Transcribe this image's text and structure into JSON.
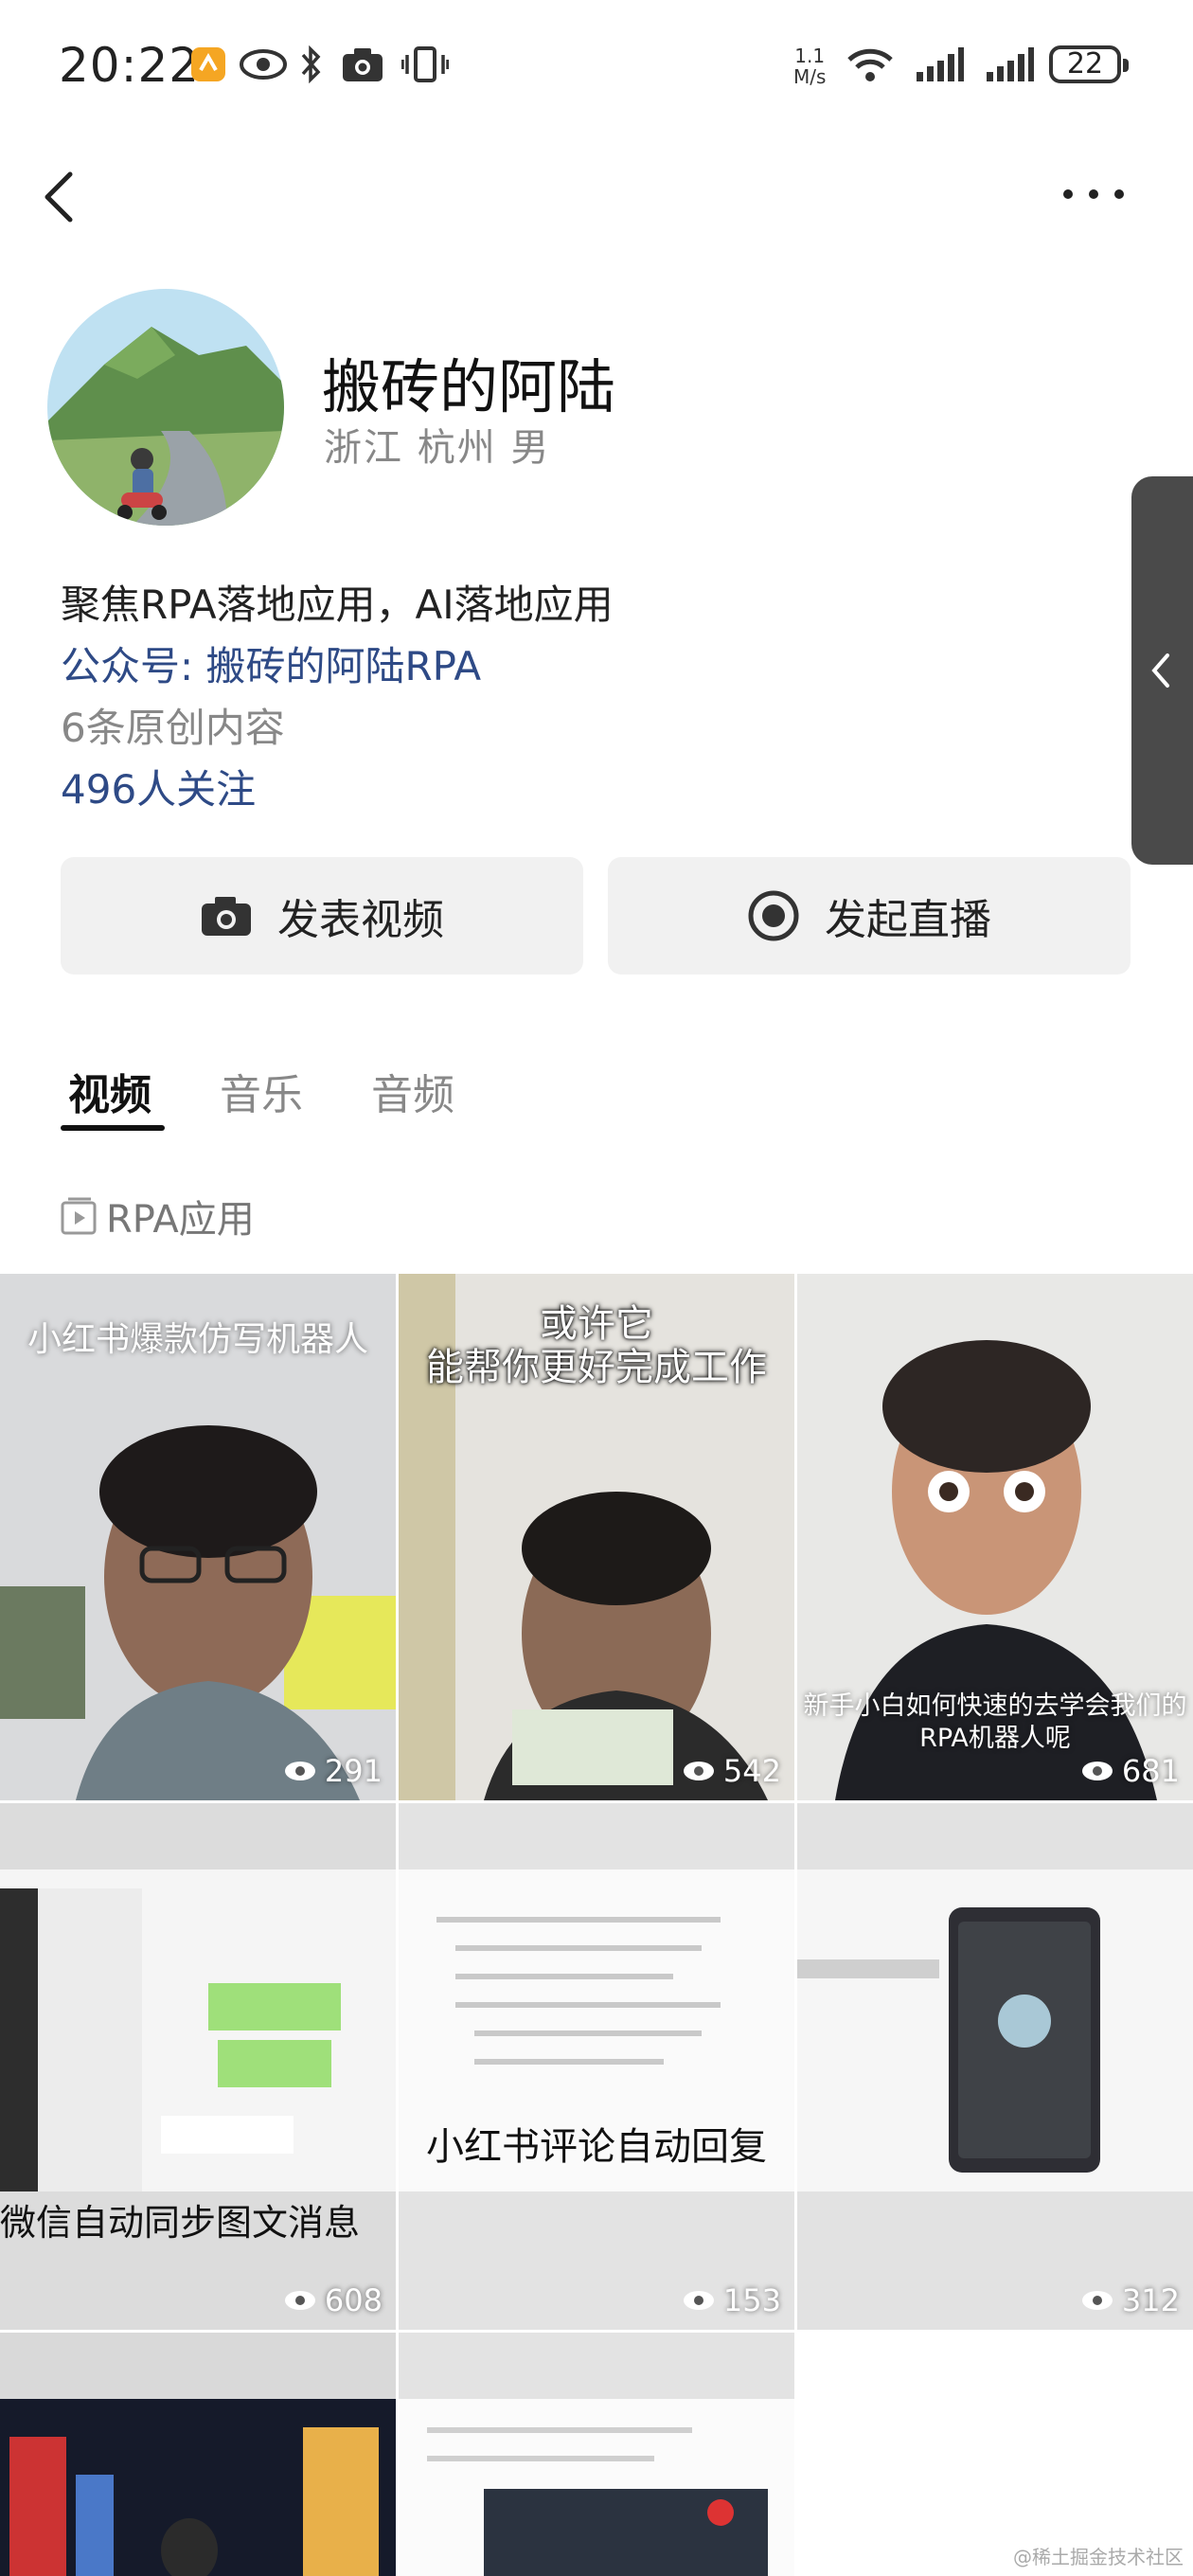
{
  "status_bar": {
    "time": "20:22",
    "net_speed_value": "1.1",
    "net_speed_unit": "M/s",
    "battery": "22"
  },
  "header": {
    "back_icon": "chevron-left-icon",
    "more_icon": "more-dots-icon"
  },
  "profile": {
    "name": "搬砖的阿陆",
    "location": "浙江 杭州 男",
    "bio": "聚焦RPA落地应用，AI落地应用",
    "official_account": "公众号: 搬砖的阿陆RPA",
    "original_count": "6条原创内容",
    "followers": "496人关注"
  },
  "actions": {
    "post_video": "发表视频",
    "start_live": "发起直播"
  },
  "tabs": [
    {
      "label": "视频",
      "active": true
    },
    {
      "label": "音乐",
      "active": false
    },
    {
      "label": "音频",
      "active": false
    }
  ],
  "collection": {
    "label": "RPA应用"
  },
  "videos": [
    {
      "caption": "小红书爆款仿写机器人",
      "views": "291"
    },
    {
      "caption": "或许它\n能帮你更好完成工作",
      "views": "542"
    },
    {
      "caption": "新手小白如何快速的去学会我们的\nRPA机器人呢",
      "views": "681"
    },
    {
      "caption": "微信自动同步图文消息",
      "views": "608"
    },
    {
      "caption": "小红书评论自动回复",
      "views": "153"
    },
    {
      "caption": "",
      "views": "312"
    }
  ],
  "watermark": "@稀土掘金技术社区",
  "colors": {
    "link": "#2e4a86",
    "secondary_text": "#888888",
    "button_bg": "#f1f1f1"
  }
}
